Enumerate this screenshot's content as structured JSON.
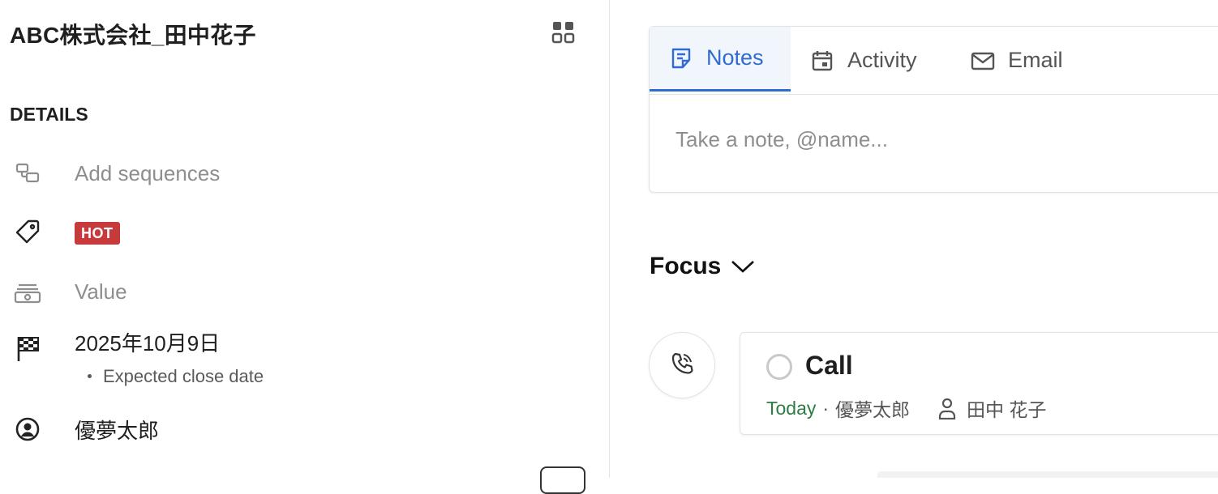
{
  "record": {
    "title": "ABC株式会社_田中花子"
  },
  "details": {
    "label": "DETAILS",
    "sequences": {
      "text": "Add sequences",
      "icon": "sequences-icon"
    },
    "tag": {
      "text": "HOT",
      "icon": "tag-icon",
      "color": "#c8393b"
    },
    "value": {
      "text": "Value",
      "icon": "money-icon"
    },
    "close_date": {
      "text": "2025年10月9日",
      "sub": "Expected close date",
      "icon": "checkered-flag-icon"
    },
    "owner": {
      "text": "優夢太郎",
      "icon": "user-circle-icon"
    }
  },
  "composer": {
    "tabs": [
      {
        "label": "Notes",
        "icon": "notes-icon",
        "active": true
      },
      {
        "label": "Activity",
        "icon": "calendar-icon",
        "active": false
      },
      {
        "label": "Email",
        "icon": "mail-icon",
        "active": false
      }
    ],
    "placeholder": "Take a note, @name..."
  },
  "focus": {
    "label": "Focus",
    "items": [
      {
        "type": "Call",
        "icon": "phone-icon",
        "due": "Today",
        "owner": "優夢太郎",
        "contact": "田中 花子"
      }
    ]
  },
  "colors": {
    "accent": "#2f6bd1",
    "today": "#2e7d46",
    "hot": "#c8393b"
  }
}
